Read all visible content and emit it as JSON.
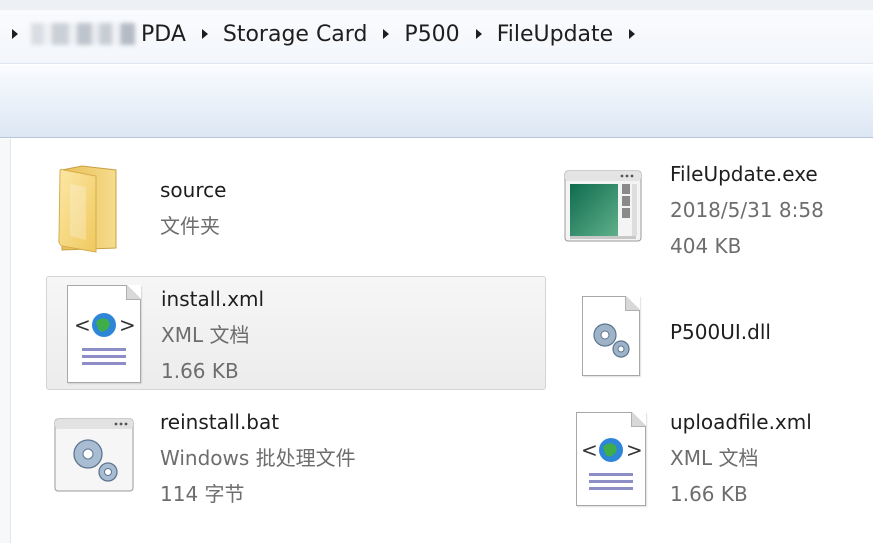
{
  "breadcrumb": {
    "items": [
      {
        "label": "PDA"
      },
      {
        "label": "Storage Card"
      },
      {
        "label": "P500"
      },
      {
        "label": "FileUpdate"
      }
    ]
  },
  "files": [
    {
      "name": "source",
      "line2": "文件夹",
      "line3": "",
      "icon": "folder-icon"
    },
    {
      "name": "FileUpdate.exe",
      "line2": "2018/5/31 8:58",
      "line3": "404 KB",
      "icon": "application-icon"
    },
    {
      "name": "install.xml",
      "line2": "XML 文档",
      "line3": "1.66 KB",
      "icon": "xml-document-icon"
    },
    {
      "name": "P500UI.dll",
      "line2": "",
      "line3": "",
      "icon": "dll-gear-icon"
    },
    {
      "name": "reinstall.bat",
      "line2": "Windows 批处理文件",
      "line3": "114 字节",
      "icon": "batch-gear-icon"
    },
    {
      "name": "uploadfile.xml",
      "line2": "XML 文档",
      "line3": "1.66 KB",
      "icon": "xml-document-icon"
    }
  ],
  "colors": {
    "folder": "#f3d177",
    "xml_globe": "#2e86d6",
    "selection": "#ececec"
  }
}
